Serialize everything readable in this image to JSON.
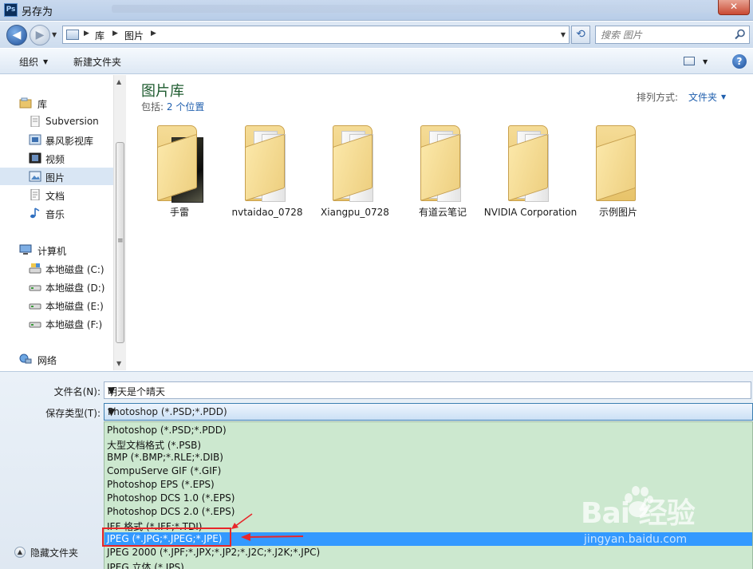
{
  "window": {
    "title": "另存为",
    "app_icon": "Ps",
    "close_label": "✕"
  },
  "address": {
    "crumbs": [
      "库",
      "图片"
    ],
    "search_placeholder": "搜索 图片"
  },
  "toolbar": {
    "organize": "组织",
    "new_folder": "新建文件夹",
    "help": "?"
  },
  "sidebar": {
    "items": [
      {
        "label": "库",
        "icon": "library-icon"
      },
      {
        "label": "Subversion",
        "icon": "document-icon"
      },
      {
        "label": "暴风影视库",
        "icon": "video-library-icon"
      },
      {
        "label": "视频",
        "icon": "video-icon"
      },
      {
        "label": "图片",
        "icon": "pictures-icon",
        "selected": true
      },
      {
        "label": "文档",
        "icon": "documents-icon"
      },
      {
        "label": "音乐",
        "icon": "music-icon"
      },
      {
        "label": "计算机",
        "icon": "computer-icon"
      },
      {
        "label": "本地磁盘 (C:)",
        "icon": "drive-icon"
      },
      {
        "label": "本地磁盘 (D:)",
        "icon": "drive-icon"
      },
      {
        "label": "本地磁盘 (E:)",
        "icon": "drive-icon"
      },
      {
        "label": "本地磁盘 (F:)",
        "icon": "drive-icon"
      },
      {
        "label": "网络",
        "icon": "network-icon"
      }
    ]
  },
  "library": {
    "title": "图片库",
    "includes_prefix": "包括:",
    "includes_link": "2 个位置",
    "arrange_label": "排列方式:",
    "arrange_value": "文件夹"
  },
  "folders": [
    {
      "name": "手雷",
      "has_photo": true
    },
    {
      "name": "nvtaidao_0728"
    },
    {
      "name": "Xiangpu_0728"
    },
    {
      "name": "有道云笔记"
    },
    {
      "name": "NVIDIA Corporation"
    },
    {
      "name": "示例图片"
    }
  ],
  "save": {
    "filename_label": "文件名(N):",
    "filename_value": "明天是个晴天",
    "type_label": "保存类型(T):",
    "type_value": "Photoshop (*.PSD;*.PDD)",
    "options": [
      "Photoshop (*.PSD;*.PDD)",
      "大型文档格式 (*.PSB)",
      "BMP (*.BMP;*.RLE;*.DIB)",
      "CompuServe GIF (*.GIF)",
      "Photoshop EPS (*.EPS)",
      "Photoshop DCS 1.0 (*.EPS)",
      "Photoshop DCS 2.0 (*.EPS)",
      "IFF 格式 (*.IFF;*.TDI)",
      "JPEG (*.JPG;*.JPEG;*.JPE)",
      "JPEG 2000 (*.JPF;*.JPX;*.JP2;*.J2C;*.J2K;*.JPC)",
      "JPEG 立体 (*.JPS)"
    ],
    "highlighted_option": "JPEG (*.JPG;*.JPEG;*.JPE)",
    "hide_folders": "隐藏文件夹"
  },
  "watermark": {
    "brand": "Bai  经验",
    "site": "jingyan.baidu.com"
  },
  "colors": {
    "highlight": "#3399ff",
    "options_bg": "#cce8cf",
    "annotation": "#e8262a",
    "library_title": "#1e5b2f"
  }
}
